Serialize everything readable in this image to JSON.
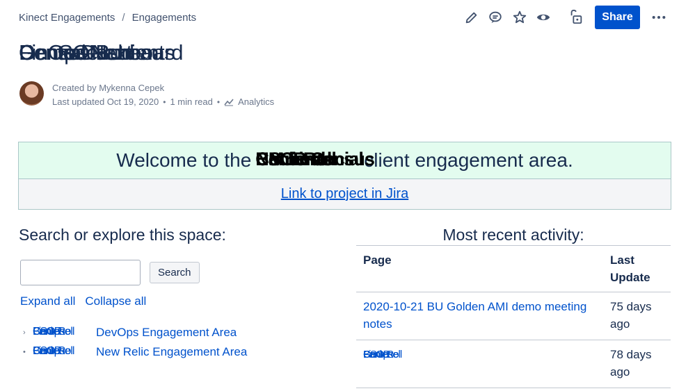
{
  "breadcrumb": {
    "space": "Kinect Engagements",
    "separator": "/",
    "page": "Engagements"
  },
  "toolbar": {
    "share_label": "Share",
    "icons": [
      "edit-icon",
      "comment-icon",
      "star-icon",
      "watch-icon",
      "restrictions-icon",
      "more-icon"
    ]
  },
  "title": {
    "overlapping_layers": [
      "Census Bureau",
      "FinOps",
      "Central Nutrients",
      "Centene",
      "Demo Dashboard",
      "GenSONext"
    ]
  },
  "byline": {
    "created": "Created by Mykenna Cepek",
    "last_updated": "Last updated Oct 19, 2020",
    "read_time": "1 min read",
    "analytics_label": "Analytics"
  },
  "welcome": {
    "prefix": "Welcome to the",
    "client_layers": [
      "Bank Roll",
      "Centeral",
      "CSCR Census",
      "BM Financial",
      "Nutrients"
    ],
    "suffix": "client engagement area."
  },
  "jira": {
    "link_label": "Link to project in Jira"
  },
  "search": {
    "title": "Search or explore this space:",
    "input_value": "",
    "button_label": "Search"
  },
  "tree": {
    "expand_label": "Expand all",
    "collapse_label": "Collapse all",
    "items": [
      {
        "client_layers": [
          "Bank Roll",
          "Centene",
          "CSCR",
          "FinOps"
        ],
        "suffix": "DevOps Engagement Area",
        "bullet": "›"
      },
      {
        "client_layers": [
          "Bank Roll",
          "Centene",
          "CSCR",
          "FinOps"
        ],
        "suffix": "New Relic Engagement Area",
        "bullet": "•"
      }
    ]
  },
  "recent": {
    "title": "Most recent activity:",
    "headers": [
      "Page",
      "Last Update"
    ],
    "rows": [
      {
        "page": "2020-10-21 BU Golden AMI demo meeting notes",
        "age": "75 days ago"
      },
      {
        "page_layers": [
          "Bank Roll",
          "Centene",
          "CSCR",
          "FinOps"
        ],
        "age": "78 days ago"
      }
    ]
  }
}
